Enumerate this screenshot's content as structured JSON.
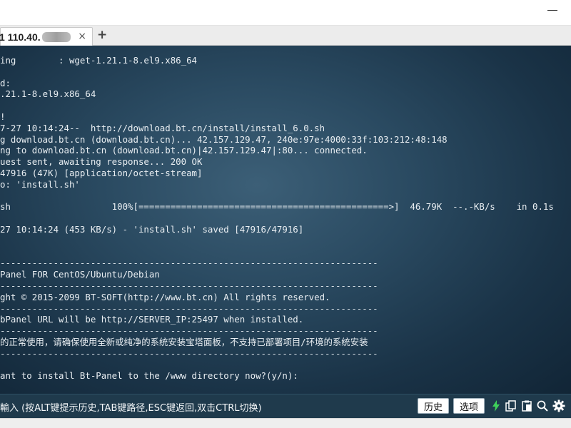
{
  "tab": {
    "title": "1 110.40.",
    "close_glyph": "×",
    "add_glyph": "+"
  },
  "terminal_lines": [
    "ing        : wget-1.21.1-8.el9.x86_64",
    "",
    "d:",
    ".21.1-8.el9.x86_64",
    "",
    "!",
    "7-27 10:14:24--  http://download.bt.cn/install/install_6.0.sh",
    "g download.bt.cn (download.bt.cn)... 42.157.129.47, 240e:97e:4000:33f:103:212:48:148",
    "ng to download.bt.cn (download.bt.cn)|42.157.129.47|:80... connected.",
    "uest sent, awaiting response... 200 OK",
    "47916 (47K) [application/octet-stream]",
    "o: 'install.sh'",
    "",
    "sh                   100%[===============================================>]  46.79K  --.-KB/s    in 0.1s",
    "",
    "27 10:14:24 (453 KB/s) - 'install.sh' saved [47916/47916]",
    "",
    "",
    "-----------------------------------------------------------------------",
    "Panel FOR CentOS/Ubuntu/Debian",
    "-----------------------------------------------------------------------",
    "ght © 2015-2099 BT-SOFT(http://www.bt.cn) All rights reserved.",
    "-----------------------------------------------------------------------",
    "bPanel URL will be http://SERVER_IP:25497 when installed.",
    "-----------------------------------------------------------------------",
    "的正常使用，请确保使用全新或纯净的系统安装宝塔面板，不支持已部署项目/环境的系统安装",
    "-----------------------------------------------------------------------",
    "",
    "ant to install Bt-Panel to the /www directory now?(y/n):"
  ],
  "command_bar": {
    "hint": "輸入 (按ALT键提示历史,TAB键路径,ESC键返回,双击CTRL切换)",
    "history_button": "历史",
    "options_button": "选项"
  },
  "icons": {
    "lightning": "lightning-icon",
    "copy": "copy-icon",
    "paste": "paste-icon",
    "search": "search-icon",
    "settings": "gear-icon"
  },
  "colors": {
    "lightning": "#3fd15a",
    "command_bar": "#1f3a4c",
    "terminal_text": "#e9eef2"
  }
}
